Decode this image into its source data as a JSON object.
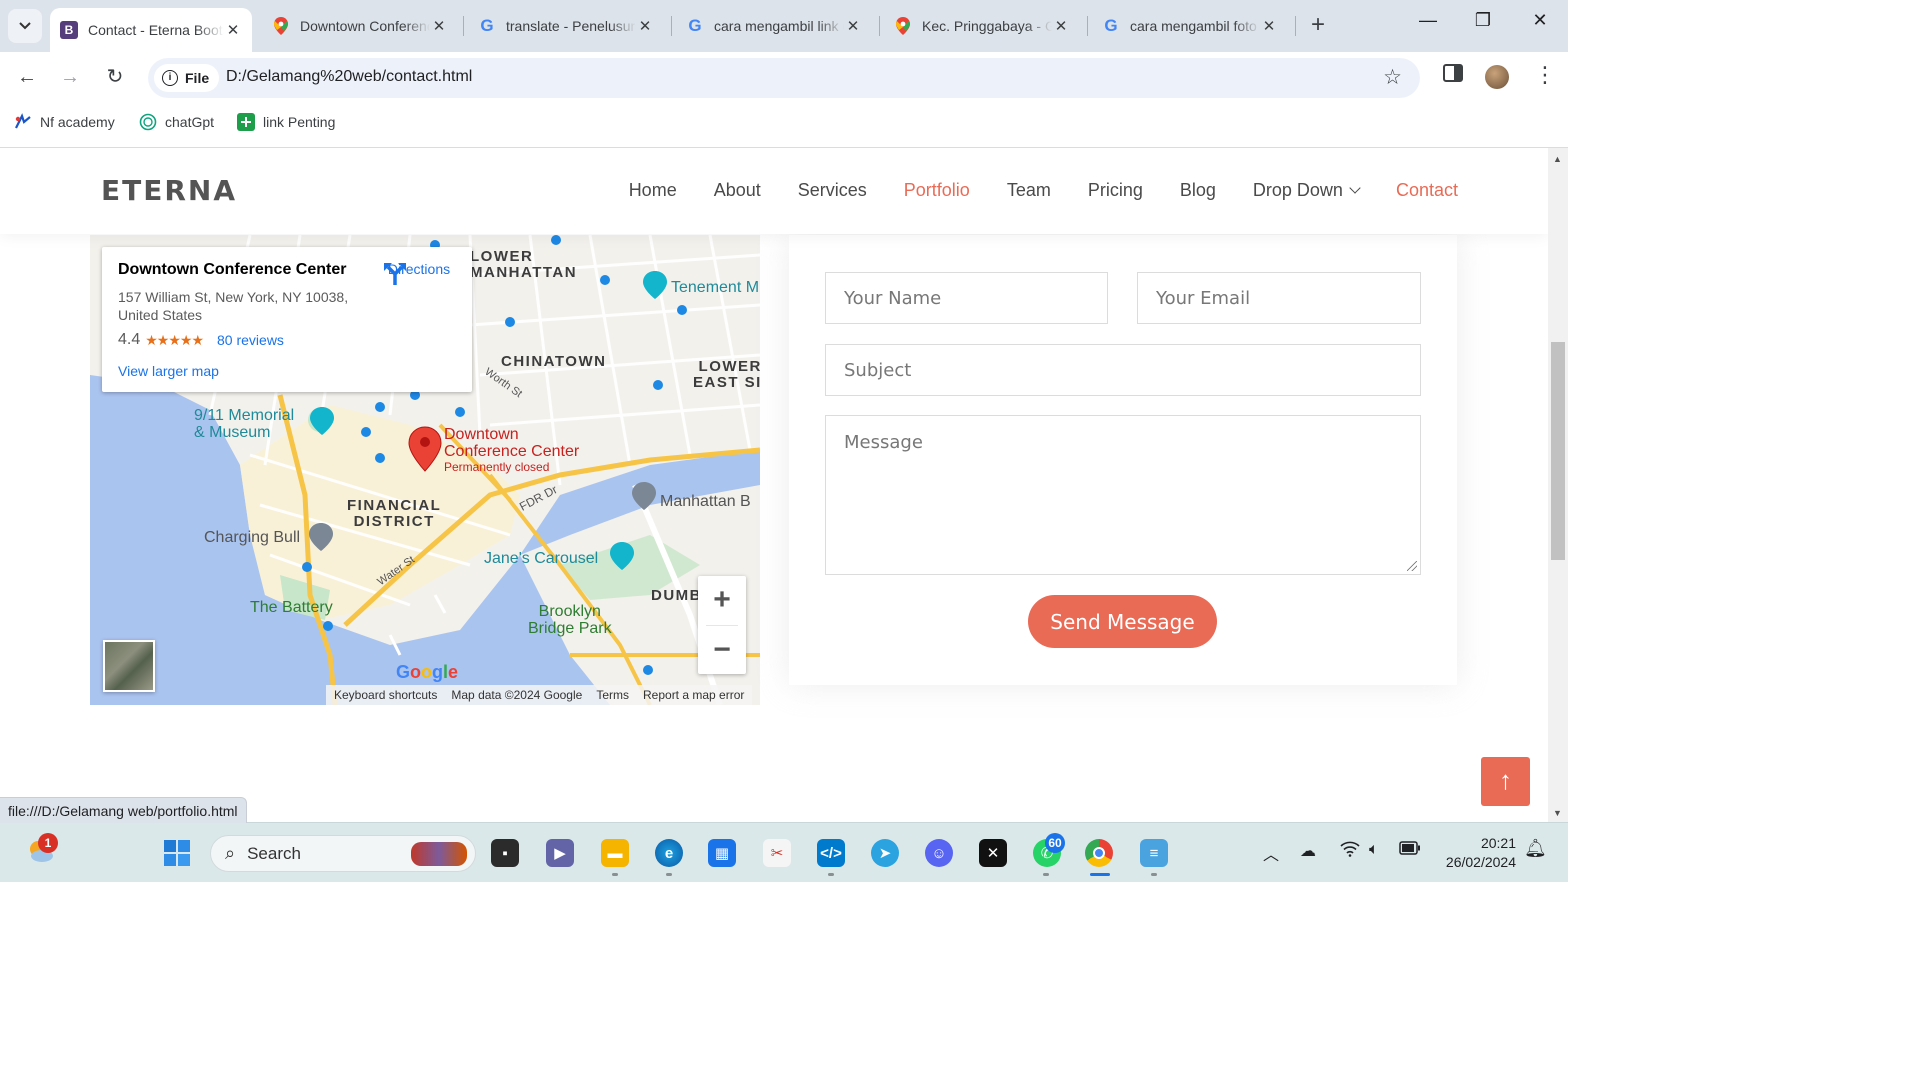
{
  "browser": {
    "tabs": [
      {
        "title": "Contact - Eterna Bootstrap Template",
        "favicon": "B",
        "active": true
      },
      {
        "title": "Downtown Conference Center",
        "favicon": "maps-pin"
      },
      {
        "title": "translate - Penelusuran Google",
        "favicon": "G"
      },
      {
        "title": "cara mengambil link google maps",
        "favicon": "G"
      },
      {
        "title": "Kec. Pringgabaya - Google Maps",
        "favicon": "maps-pin"
      },
      {
        "title": "cara mengambil foto",
        "favicon": "G"
      }
    ],
    "new_tab": "+",
    "window_controls": {
      "minimize": "—",
      "restore": "❐",
      "close": "✕"
    },
    "toolbar": {
      "back": "←",
      "forward": "→",
      "reload": "↻",
      "chip_label": "File",
      "url": "D:/Gelamang%20web/contact.html",
      "bookmark_star": "☆",
      "menu": "⋮"
    },
    "bookmarks": [
      {
        "label": "Nf academy",
        "icon": "nf-icon"
      },
      {
        "label": "chatGpt",
        "icon": "chatgpt-icon"
      },
      {
        "label": "link Penting",
        "icon": "sheets-icon"
      }
    ],
    "status_url": "file:///D:/Gelamang web/portfolio.html"
  },
  "site": {
    "logo": "ETERNA",
    "nav": [
      {
        "label": "Home"
      },
      {
        "label": "About"
      },
      {
        "label": "Services"
      },
      {
        "label": "Portfolio",
        "active": true
      },
      {
        "label": "Team"
      },
      {
        "label": "Pricing"
      },
      {
        "label": "Blog"
      },
      {
        "label": "Drop Down"
      },
      {
        "label": "Contact",
        "active": true
      }
    ],
    "accent_color": "#e96b56"
  },
  "map": {
    "place_name": "Downtown Conference Center",
    "address": "157 William St, New York, NY 10038, United States",
    "rating": "4.4",
    "stars": "★★★★★",
    "reviews": "80 reviews",
    "directions": "Directions",
    "view_larger": "View larger map",
    "labels": {
      "lower_manhattan": "LOWER\nMANHATTAN",
      "tenement": "Tenement M",
      "chinatown": "CHINATOWN",
      "lower_east": "LOWER\nEAST SI",
      "memorial": "9/11 Memorial\n& Museum",
      "pin_title": "Downtown\nConference Center",
      "pin_status": "Permanently closed",
      "fdr": "FDR Dr",
      "manhattan_b": "Manhattan B",
      "financial": "FINANCIAL\nDISTRICT",
      "charging_bull": "Charging Bull",
      "janes": "Jane's Carousel",
      "water_st": "Water St",
      "worth_st": "Worth St",
      "battery": "The Battery",
      "brooklyn": "Brooklyn\nBridge Park",
      "dumbo": "DUMB"
    },
    "zoom_in": "+",
    "zoom_out": "−",
    "google": "Google",
    "attrib": [
      "Keyboard shortcuts",
      "Map data ©2024 Google",
      "Terms",
      "Report a map error"
    ]
  },
  "form": {
    "name_placeholder": "Your Name",
    "email_placeholder": "Your Email",
    "subject_placeholder": "Subject",
    "message_placeholder": "Message",
    "submit": "Send Message"
  },
  "back_to_top": "↑",
  "taskbar": {
    "search": "Search",
    "weather_badge": "1",
    "whatsapp_badge": "60",
    "time": "20:21",
    "date": "26/02/2024"
  }
}
